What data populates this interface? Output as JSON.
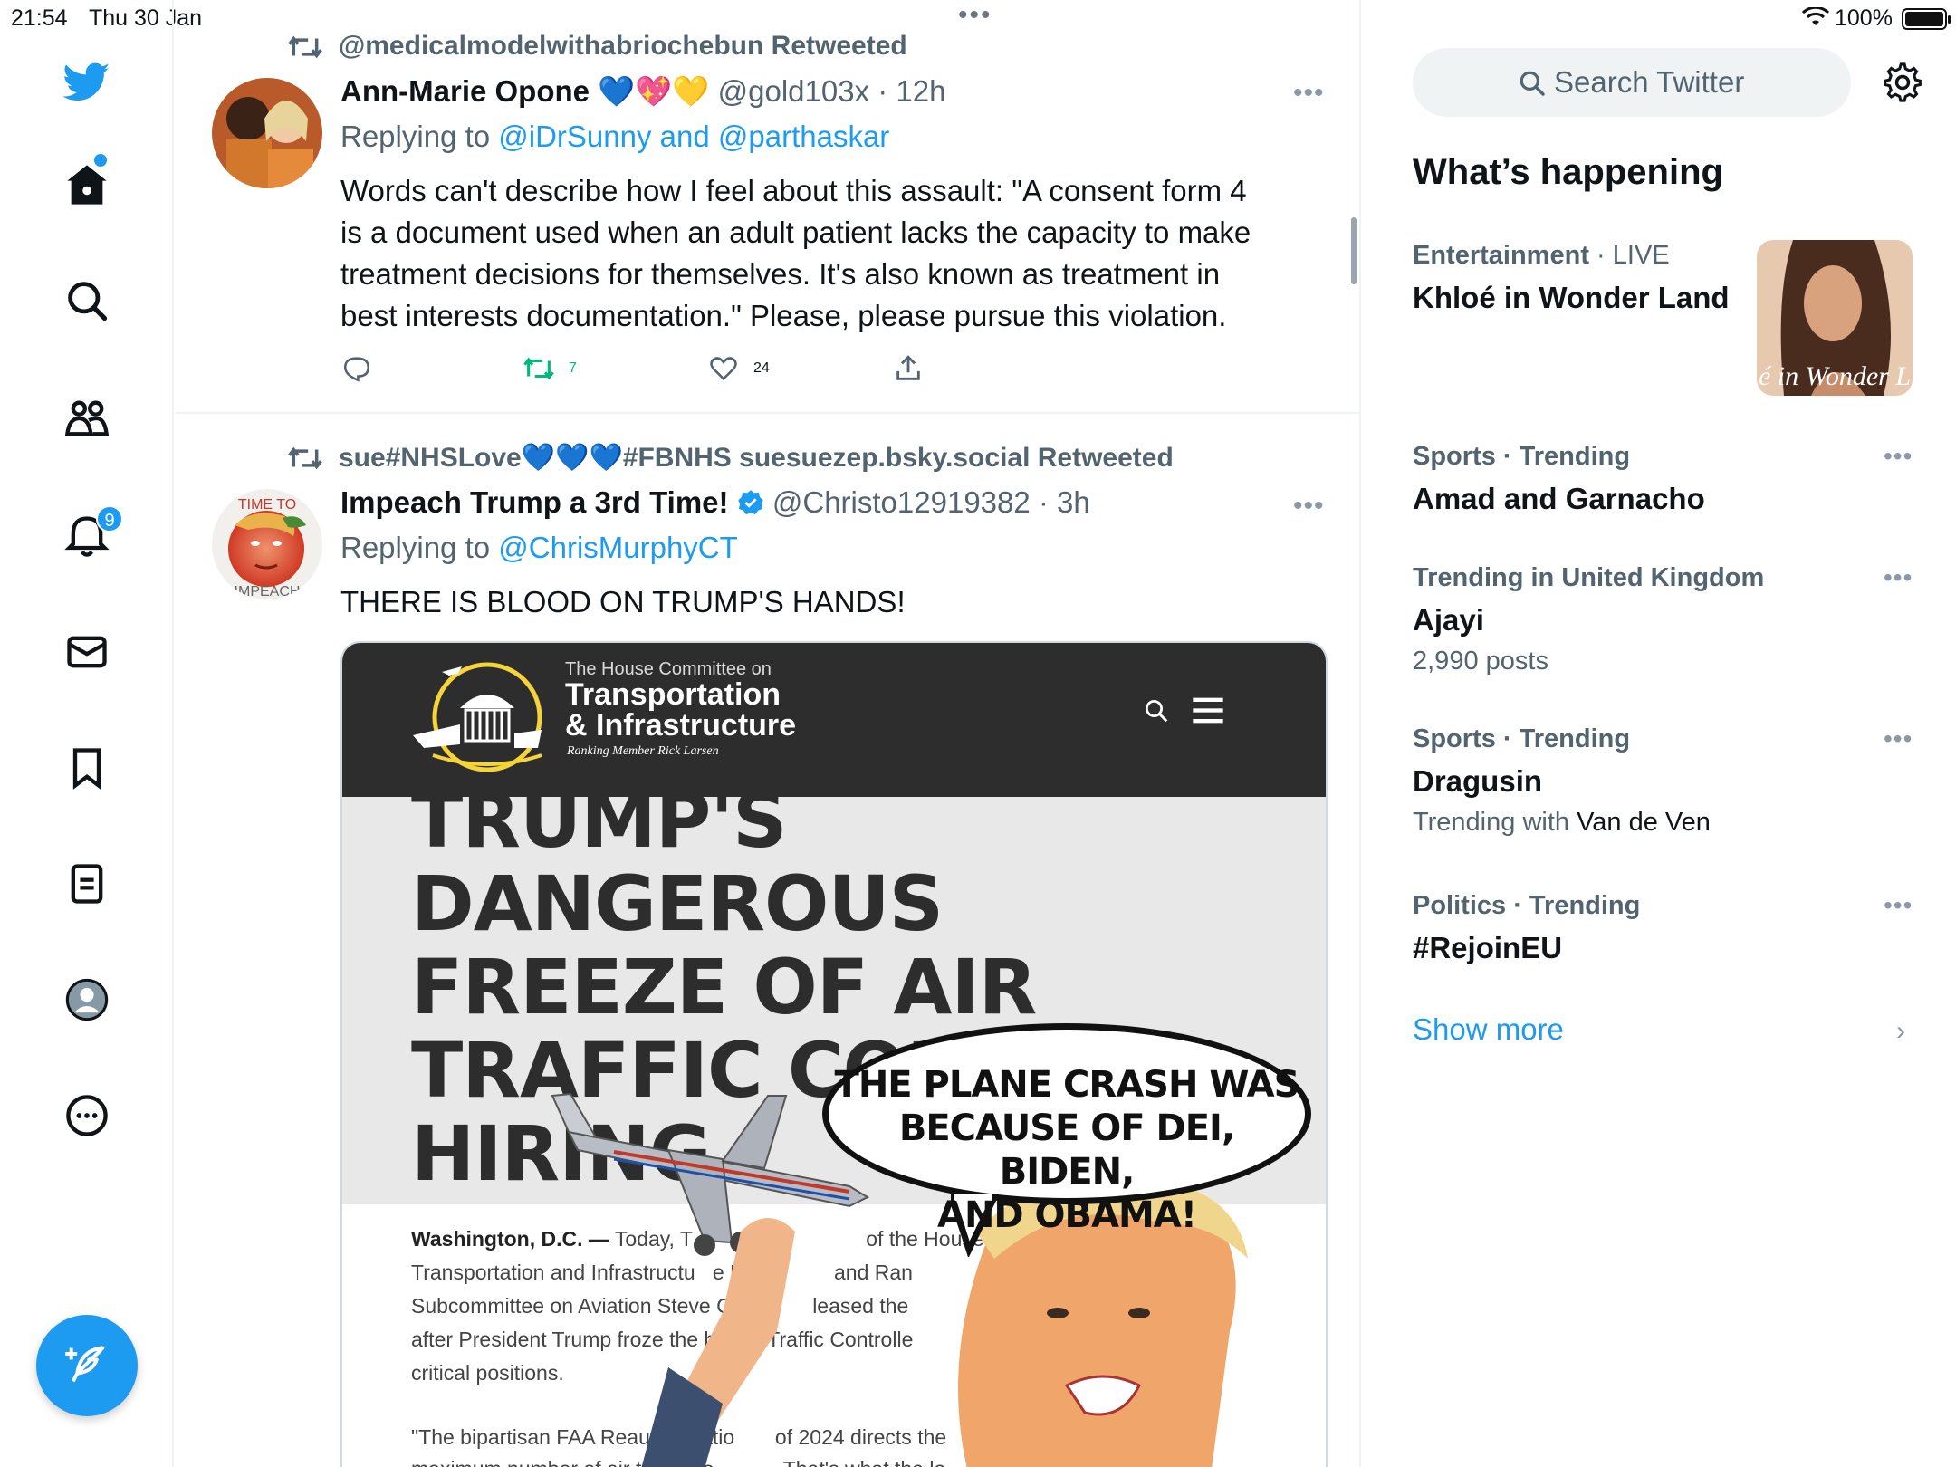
{
  "status_bar": {
    "time": "21:54",
    "date": "Thu 30 Jan",
    "battery": "100%"
  },
  "nav": {
    "notifications_count": "9"
  },
  "tweets": [
    {
      "retweeted_by": "@medicalmodelwithabriochebun Retweeted",
      "name": "Ann-Marie Opone",
      "emoji": "💙💖💛",
      "handle": "@gold103x · 12h",
      "replying_prefix": "Replying to ",
      "replying_to": "@iDrSunny and @parthaskar",
      "text_lines": [
        "Words can't describe how I feel about this assault: \"A consent form 4",
        "is a document used when an adult patient lacks the capacity to make",
        "treatment decisions for themselves. It's also known as treatment in",
        "best interests documentation.\" Please, please pursue this violation."
      ],
      "retweets": "7",
      "likes": "24"
    },
    {
      "retweeted_by": "sue#NHSLove💙💙💙#FBNHS suesuezep.bsky.social Retweeted",
      "name": "Impeach Trump a 3rd Time!",
      "handle": "@Christo12919382 · 3h",
      "replying_prefix": "Replying to ",
      "replying_to": "@ChrisMurphyCT",
      "text": "THERE IS BLOOD ON TRUMP'S HANDS!",
      "avatar_caption_top": "TIME TO",
      "avatar_caption_bottom": "IMPEACH",
      "media": {
        "committee_small": "The House Committee on",
        "committee_big_1": "Transportation",
        "committee_big_2": "& Infrastructure",
        "committee_rank": "Ranking Member Rick Larsen",
        "headline": [
          "TRUMP'S DANGEROUS",
          "FREEZE OF AIR",
          "TRAFFIC CONTROL",
          "HIRING"
        ],
        "press_lead": "Washington, D.C. —",
        "press_lines": [
          " Today, T                              of the House Com",
          "Transportation and Infrastructu   e Rick           and Ran",
          "Subcommittee on Aviation Steve Coh          leased the",
          "after President Trump froze the hir       Traffic Controlle",
          "critical positions."
        ],
        "press_lines_2": [
          "\"The bipartisan FAA Reauthorizatio       of 2024 directs the",
          "maximum number of air traffic co          . That's what the la"
        ],
        "bubble_text": [
          "THE PLANE CRASH WAS",
          "BECAUSE OF DEI, BIDEN,",
          "AND OBAMA!"
        ]
      }
    }
  ],
  "sidebar": {
    "search_placeholder": "Search Twitter",
    "title": "What’s happening",
    "trends": [
      {
        "category": "Entertainment",
        "extra": " · LIVE",
        "name": "Khloé in Wonder Land",
        "thumb_caption": "é in Wonder L"
      },
      {
        "category": "Sports · Trending",
        "name": "Amad and Garnacho"
      },
      {
        "category": "Trending in United Kingdom",
        "name": "Ajayi",
        "sub": "2,990 posts"
      },
      {
        "category": "Sports · Trending",
        "name": "Dragusin",
        "sub_prefix": "Trending with ",
        "sub_value": "Van de Ven"
      },
      {
        "category": "Politics · Trending",
        "name": "#RejoinEU"
      }
    ],
    "show_more": "Show more"
  },
  "colors": {
    "accent": "#1d9bf0",
    "retweet_green": "#00ba7c",
    "muted": "#536471"
  }
}
